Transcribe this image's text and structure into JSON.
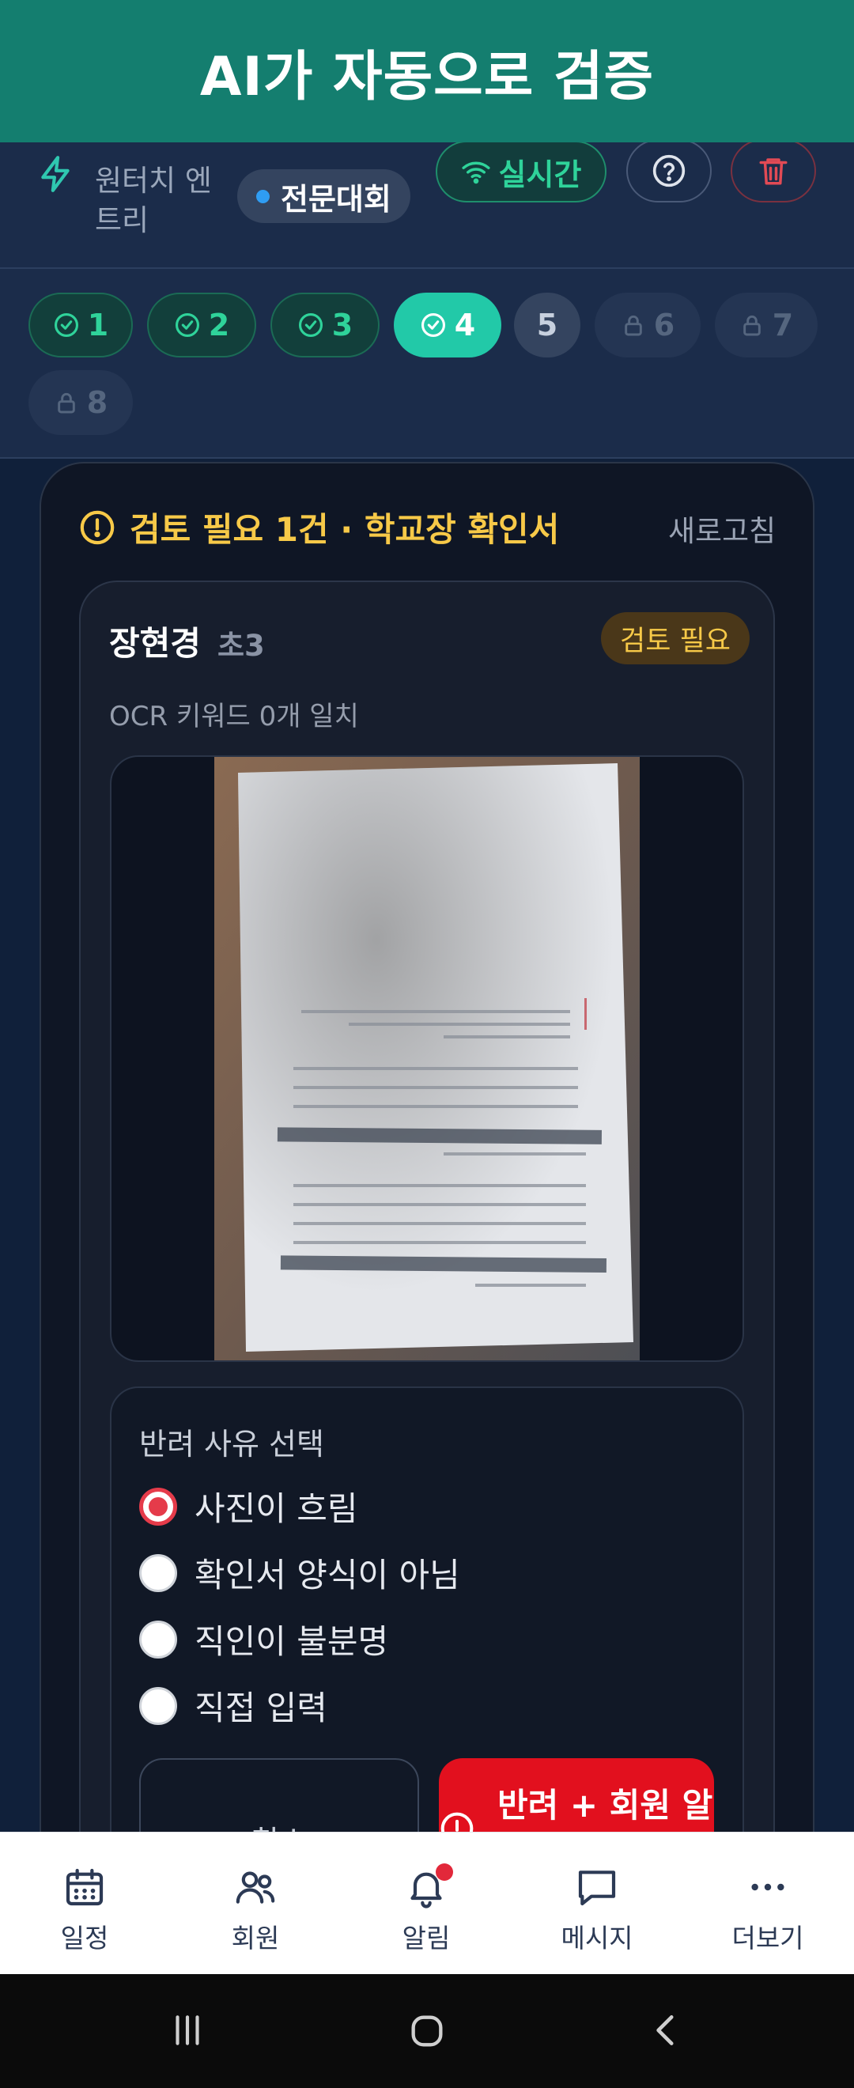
{
  "banner": {
    "title": "AI가 자동으로 검증"
  },
  "header": {
    "subtitle_line1": "원터치 엔",
    "subtitle_line2": "트리",
    "category_chip": "전문대회",
    "live_label": "실시간",
    "icons": [
      "bolt-icon",
      "help-icon",
      "trash-icon",
      "wifi-icon"
    ]
  },
  "steps": [
    {
      "label": "1",
      "state": "done"
    },
    {
      "label": "2",
      "state": "done"
    },
    {
      "label": "3",
      "state": "done"
    },
    {
      "label": "4",
      "state": "active"
    },
    {
      "label": "5",
      "state": "next"
    },
    {
      "label": "6",
      "state": "locked"
    },
    {
      "label": "7",
      "state": "locked"
    },
    {
      "label": "8",
      "state": "locked"
    }
  ],
  "review": {
    "title": "검토 필요 1건 · 학교장 확인서",
    "refresh_label": "새로고침",
    "card": {
      "name": "장현경",
      "grade": "초3",
      "status_badge": "검토 필요",
      "ocr_text": "OCR 키워드 0개 일치"
    }
  },
  "reject": {
    "title": "반려 사유 선택",
    "options": [
      {
        "label": "사진이 흐림",
        "selected": true
      },
      {
        "label": "확인서 양식이 아님",
        "selected": false
      },
      {
        "label": "직인이 불분명",
        "selected": false
      },
      {
        "label": "직접 입력",
        "selected": false
      }
    ],
    "cancel_label": "취소",
    "submit_label": "반려 + 회원 알"
  },
  "nav": {
    "items": [
      {
        "label": "일정",
        "icon": "calendar-icon"
      },
      {
        "label": "회원",
        "icon": "users-icon"
      },
      {
        "label": "알림",
        "icon": "bell-icon"
      },
      {
        "label": "메시지",
        "icon": "message-icon"
      },
      {
        "label": "더보기",
        "icon": "more-icon"
      }
    ]
  },
  "colors": {
    "banner": "#147e6f",
    "accent": "#22c9a8",
    "warning": "#f7c948",
    "danger": "#e2101e"
  }
}
